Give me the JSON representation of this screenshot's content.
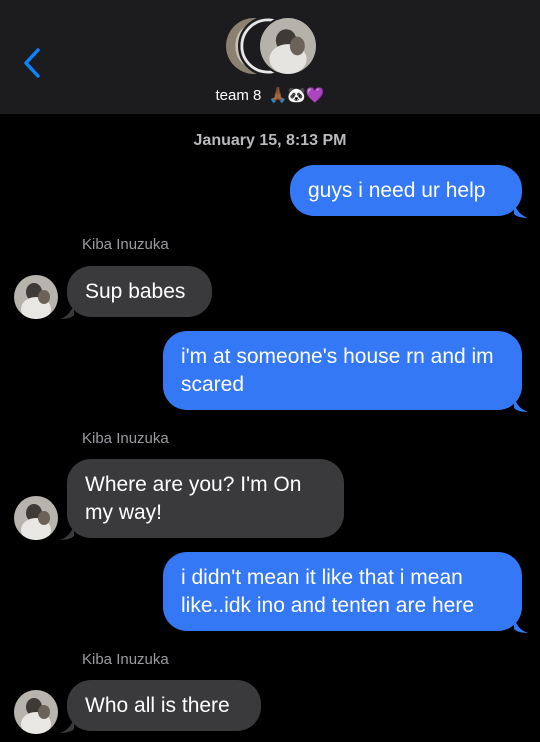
{
  "header": {
    "group_name": "team 8",
    "group_emojis": "🙏🏾🐼💜"
  },
  "conversation": {
    "timestamp": "January 15, 8:13 PM",
    "messages": [
      {
        "from": "me",
        "text": "guys i need ur help"
      },
      {
        "from": "Kiba Inuzuka",
        "sender_label": "Kiba Inuzuka",
        "text": "Sup babes"
      },
      {
        "from": "me",
        "text": "i'm at someone's house rn and im scared"
      },
      {
        "from": "Kiba Inuzuka",
        "sender_label": "Kiba Inuzuka",
        "text": "Where are you? I'm On my way!"
      },
      {
        "from": "me",
        "text": "i didn't mean it like that i mean like..idk ino and tenten are here"
      },
      {
        "from": "Kiba Inuzuka",
        "sender_label": "Kiba Inuzuka",
        "text": "Who all is there"
      }
    ]
  },
  "colors": {
    "sent_bubble": "#3478f6",
    "received_bubble": "#3a3a3c",
    "header_bg": "#1c1c1e",
    "background": "#000000",
    "accent": "#0a84ff"
  }
}
